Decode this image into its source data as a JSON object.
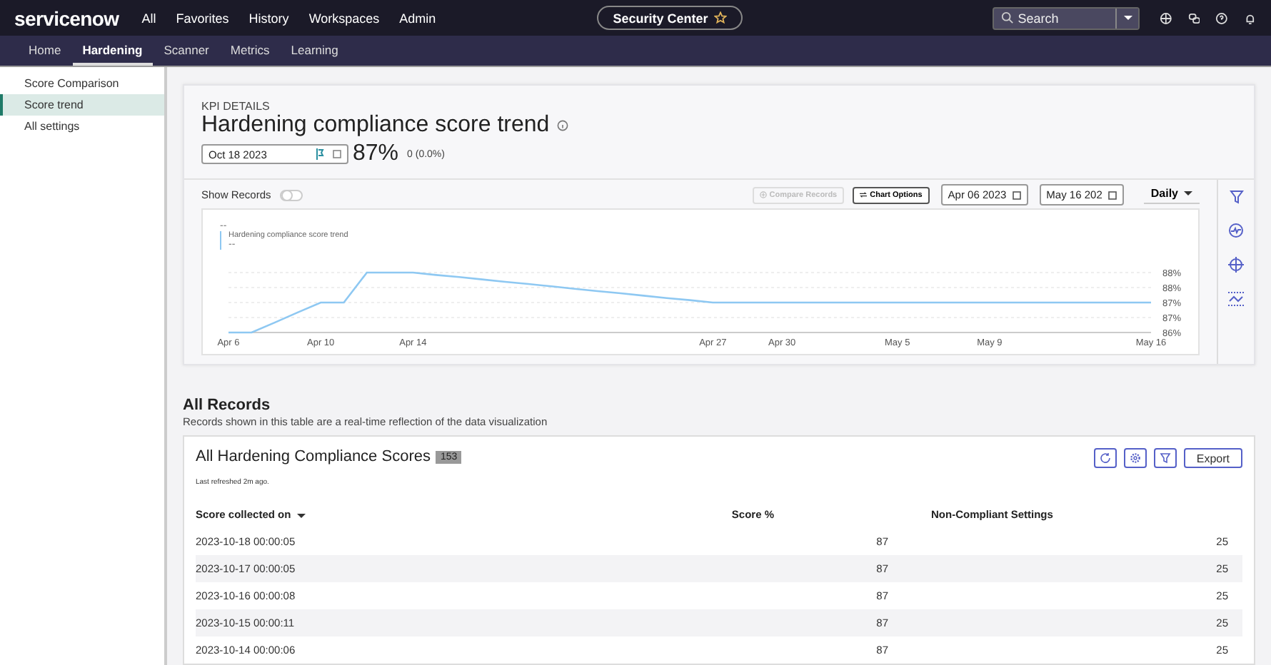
{
  "topbar": {
    "logo": "servicenow",
    "menu": [
      {
        "label": "All"
      },
      {
        "label": "Favorites"
      },
      {
        "label": "History"
      },
      {
        "label": "Workspaces"
      },
      {
        "label": "Admin"
      }
    ],
    "workspace_title": "Security Center",
    "search": {
      "placeholder": "Search"
    }
  },
  "subnav": {
    "tabs": [
      {
        "label": "Home",
        "selected": false
      },
      {
        "label": "Hardening",
        "selected": true
      },
      {
        "label": "Scanner",
        "selected": false
      },
      {
        "label": "Metrics",
        "selected": false
      },
      {
        "label": "Learning",
        "selected": false
      }
    ]
  },
  "sidebar": {
    "items": [
      {
        "label": "Score Comparison",
        "selected": false
      },
      {
        "label": "Score trend",
        "selected": true
      },
      {
        "label": "All settings",
        "selected": false
      }
    ]
  },
  "kpi": {
    "eyebrow": "KPI DETAILS",
    "title": "Hardening compliance score trend",
    "date": "Oct 18 2023",
    "score": "87%",
    "change": "0 (0.0%)"
  },
  "chart_panel": {
    "show_records_label": "Show Records",
    "show_records": false,
    "compare_button": "Compare Records",
    "options_button": "Chart Options",
    "start_date": "Apr 06 2023",
    "end_date": "May 16 202",
    "interval": "Daily",
    "placeholder_top": "--",
    "legend_value": "--",
    "chart_data": {
      "type": "line",
      "grid": true,
      "categories": [
        "Apr 6",
        null,
        null,
        null,
        "Apr 10",
        null,
        null,
        null,
        "Apr 14",
        null,
        null,
        null,
        null,
        null,
        null,
        null,
        null,
        null,
        null,
        null,
        null,
        "Apr 27",
        null,
        null,
        "Apr 30",
        null,
        null,
        null,
        null,
        "May 5",
        null,
        null,
        null,
        "May 9",
        null,
        null,
        null,
        null,
        null,
        null,
        "May 16"
      ],
      "series": [
        {
          "name": "Hardening compliance score trend",
          "color": "#8ec8f2",
          "values": [
            86,
            86,
            86.33,
            86.67,
            87,
            87,
            88,
            88,
            88,
            87.92,
            87.85,
            87.77,
            87.69,
            87.62,
            87.54,
            87.46,
            87.38,
            87.31,
            87.23,
            87.15,
            87.08,
            87,
            87,
            87,
            87,
            87,
            87,
            87,
            87,
            87,
            87,
            87,
            87,
            87,
            87,
            87,
            87,
            87,
            87,
            87,
            87
          ]
        }
      ],
      "ylim": [
        86,
        88
      ],
      "yticks": [
        {
          "value": 86,
          "label": "86%"
        },
        {
          "value": 86.5,
          "label": "87%"
        },
        {
          "value": 87,
          "label": "87%"
        },
        {
          "value": 87.5,
          "label": "88%"
        },
        {
          "value": 88,
          "label": "88%"
        }
      ]
    }
  },
  "records": {
    "title": "All Records",
    "subtitle": "Records shown in this table are a real-time reflection of the data visualization",
    "table_title": "All Hardening Compliance Scores",
    "count": "153",
    "refreshed": "Last refreshed 2m ago.",
    "export_button": "Export",
    "columns": [
      "Score collected on",
      "Score %",
      "Non-Compliant Settings"
    ],
    "rows": [
      [
        "2023-10-18 00:00:05",
        "87",
        "25"
      ],
      [
        "2023-10-17 00:00:05",
        "87",
        "25"
      ],
      [
        "2023-10-16 00:00:08",
        "87",
        "25"
      ],
      [
        "2023-10-15 00:00:11",
        "87",
        "25"
      ],
      [
        "2023-10-14 00:00:06",
        "87",
        "25"
      ]
    ]
  }
}
